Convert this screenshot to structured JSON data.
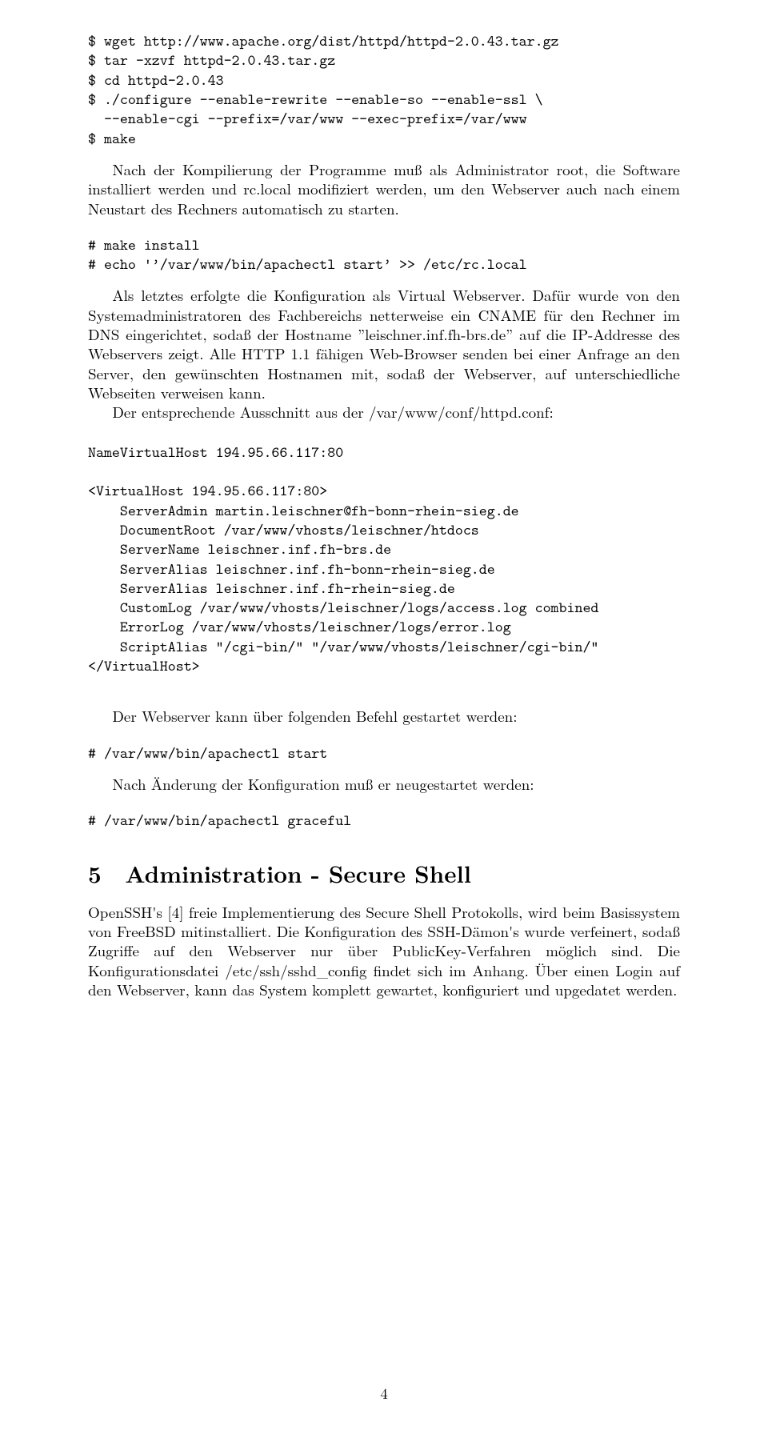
{
  "code1": "$ wget http://www.apache.org/dist/httpd/httpd-2.0.43.tar.gz\n$ tar -xzvf httpd-2.0.43.tar.gz\n$ cd httpd-2.0.43\n$ ./configure --enable-rewrite --enable-so --enable-ssl \\\n  --enable-cgi --prefix=/var/www --exec-prefix=/var/www\n$ make",
  "para1": "Nach der Kompilierung der Programme muß als Administrator root, die Software installiert werden und rc.local modifiziert werden, um den Webserver auch nach einem Neustart des Rechners automatisch zu starten.",
  "code2": "# make install\n# echo 'Apostrophe_open/var/www/bin/apachectl startApostrophe_close >> /etc/rc.local",
  "para2": "Als letztes erfolgte die Konfiguration als Virtual Webserver. Dafür wurde von den Systemadministratoren des Fachbereichs netterweise ein CNAME für den Rechner im DNS eingerichtet, sodaß der Hostname ”leischner.inf.fh-brs.de” auf die IP-Addresse des Webservers zeigt. Alle HTTP 1.1 fähigen Web-Browser senden bei einer Anfrage an den Server, den gewünschten Hostnamen mit, sodaß der Webserver, auf unterschiedliche Webseiten verweisen kann.",
  "para3": "Der entsprechende Ausschnitt aus der /var/www/conf/httpd.conf:",
  "code3": "NameVirtualHost 194.95.66.117:80\n\n<VirtualHost 194.95.66.117:80>\n    ServerAdmin martin.leischner@fh-bonn-rhein-sieg.de\n    DocumentRoot /var/www/vhosts/leischner/htdocs\n    ServerName leischner.inf.fh-brs.de\n    ServerAlias leischner.inf.fh-bonn-rhein-sieg.de\n    ServerAlias leischner.inf.fh-rhein-sieg.de\n    CustomLog /var/www/vhosts/leischner/logs/access.log combined\n    ErrorLog /var/www/vhosts/leischner/logs/error.log\n    ScriptAlias \"/cgi-bin/\" \"/var/www/vhosts/leischner/cgi-bin/\"\n</VirtualHost>",
  "para4": "Der Webserver kann über folgenden Befehl gestartet werden:",
  "code4": "# /var/www/bin/apachectl start",
  "para5": "Nach Änderung der Konfiguration muß er neugestartet werden:",
  "code5": "# /var/www/bin/apachectl graceful",
  "section": {
    "num": "5",
    "title": "Administration - Secure Shell"
  },
  "para6": "OpenSSH's [4] freie Implementierung des Secure Shell Protokolls, wird beim Basissystem von FreeBSD mitinstalliert. Die Konfiguration des SSH-Dämon's wurde verfeinert, sodaß Zugriffe auf den Webserver nur über PublicKey-Verfahren möglich sind. Die Konfigurationsdatei /etc/ssh/sshd_config findet sich im Anhang. Über einen Login auf den Webserver, kann das System komplett gewartet, konfiguriert und upgedatet werden.",
  "pageno": "4"
}
